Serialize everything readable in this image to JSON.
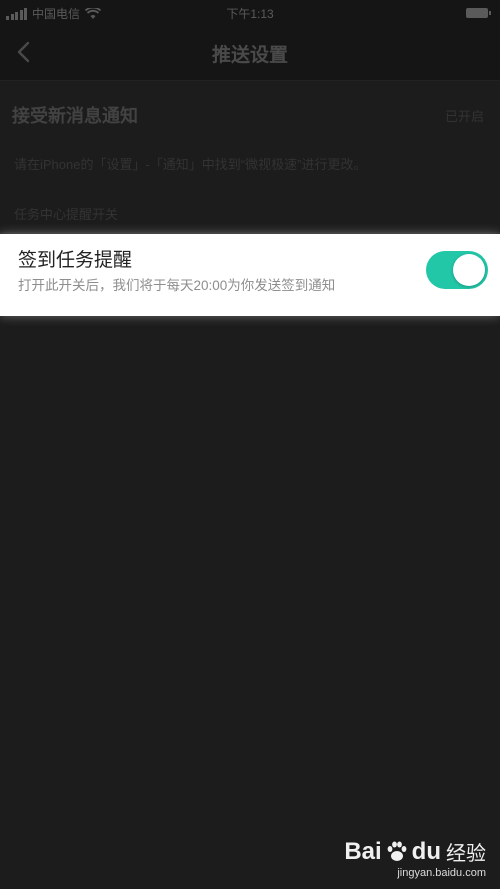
{
  "status_bar": {
    "carrier": "中国电信",
    "time": "下午1:13",
    "icons": [
      "signal-icon",
      "wifi-icon",
      "battery-icon"
    ]
  },
  "nav": {
    "title": "推送设置",
    "back_icon": "chevron-left-icon"
  },
  "section": {
    "title": "接受新消息通知",
    "right_status": "已开启",
    "hint": "请在iPhone的「设置」-「通知」中找到“微视极速”进行更改。",
    "hint2": "任务中心提醒开关"
  },
  "card": {
    "title": "签到任务提醒",
    "description": "打开此开关后，我们将于每天20:00为你发送签到通知",
    "toggle_on": true,
    "toggle_color": "#22c7a8"
  },
  "watermark": {
    "brand_latin": "Bai",
    "brand_du": "du",
    "brand_cn": "经验",
    "url": "jingyan.baidu.com"
  }
}
